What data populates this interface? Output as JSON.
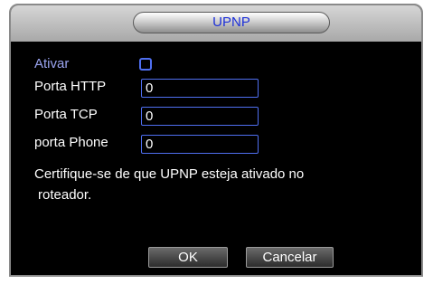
{
  "dialog": {
    "title": "UPNP"
  },
  "form": {
    "enable_label": "Ativar",
    "enable_checked": false,
    "http_port_label": "Porta HTTP",
    "http_port_value": "0",
    "tcp_port_label": "Porta TCP",
    "tcp_port_value": "0",
    "phone_port_label": "porta Phone",
    "phone_port_value": "0"
  },
  "note": {
    "line1": "Certifique-se de que UPNP esteja ativado no",
    "line2": "roteador."
  },
  "buttons": {
    "ok_label": "OK",
    "cancel_label": "Cancelar"
  },
  "colors": {
    "title_text": "#1c2fd8",
    "field_border": "#4f6ff0",
    "enable_label": "#9aa4f0",
    "background": "#000000"
  }
}
